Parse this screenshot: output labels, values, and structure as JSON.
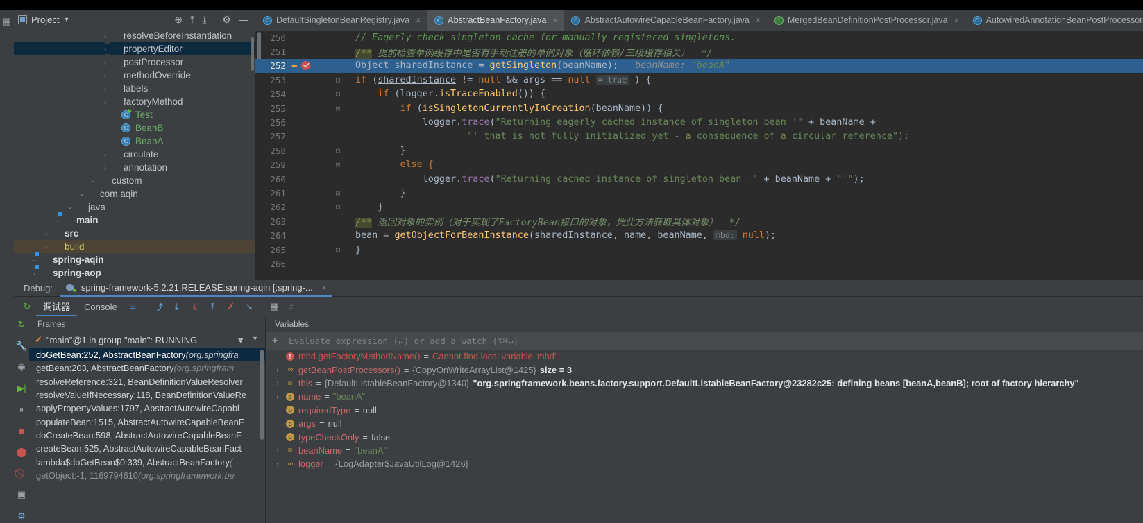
{
  "project_panel": {
    "title": "Project",
    "tools": [
      "locate-icon",
      "expand-all-icon",
      "collapse-all-icon",
      "settings-icon",
      "hide-icon"
    ],
    "tree": [
      {
        "label": "spring-aop",
        "indent": 1,
        "arrow": "›",
        "icon": "module-folder",
        "style": "bold",
        "sel": "none"
      },
      {
        "label": "spring-aqin",
        "indent": 1,
        "arrow": "⌄",
        "icon": "module-folder",
        "style": "bold",
        "sel": "none"
      },
      {
        "label": "build",
        "indent": 2,
        "arrow": "›",
        "icon": "folder-orange",
        "style": "yellowish",
        "sel": "yellow"
      },
      {
        "label": "src",
        "indent": 2,
        "arrow": "⌄",
        "icon": "folder-gray",
        "style": "bold",
        "sel": "none"
      },
      {
        "label": "main",
        "indent": 3,
        "arrow": "⌄",
        "icon": "module-folder",
        "style": "bold",
        "sel": "none"
      },
      {
        "label": "java",
        "indent": 4,
        "arrow": "⌄",
        "icon": "folder-blue",
        "style": "plain",
        "sel": "none"
      },
      {
        "label": "com.aqin",
        "indent": 5,
        "arrow": "⌄",
        "icon": "package",
        "style": "plain",
        "sel": "none"
      },
      {
        "label": "custom",
        "indent": 6,
        "arrow": "⌄",
        "icon": "package",
        "style": "plain",
        "sel": "none"
      },
      {
        "label": "annotation",
        "indent": 7,
        "arrow": "›",
        "icon": "package",
        "style": "plain",
        "sel": "none"
      },
      {
        "label": "circulate",
        "indent": 7,
        "arrow": "⌄",
        "icon": "package",
        "style": "plain",
        "sel": "none"
      },
      {
        "label": "BeanA",
        "indent": 8,
        "arrow": "",
        "icon": "class",
        "style": "green",
        "sel": "none"
      },
      {
        "label": "BeanB",
        "indent": 8,
        "arrow": "",
        "icon": "class",
        "style": "green",
        "sel": "none"
      },
      {
        "label": "Test",
        "indent": 8,
        "arrow": "",
        "icon": "class-runnable",
        "style": "green",
        "sel": "none"
      },
      {
        "label": "factoryMethod",
        "indent": 7,
        "arrow": "›",
        "icon": "package",
        "style": "plain",
        "sel": "none"
      },
      {
        "label": "labels",
        "indent": 7,
        "arrow": "›",
        "icon": "package",
        "style": "plain",
        "sel": "none"
      },
      {
        "label": "methodOverride",
        "indent": 7,
        "arrow": "›",
        "icon": "package",
        "style": "plain",
        "sel": "none"
      },
      {
        "label": "postProcessor",
        "indent": 7,
        "arrow": "›",
        "icon": "package",
        "style": "plain",
        "sel": "none"
      },
      {
        "label": "propertyEditor",
        "indent": 7,
        "arrow": "›",
        "icon": "package",
        "style": "plain",
        "sel": "blue"
      },
      {
        "label": "resolveBeforeInstantiation",
        "indent": 7,
        "arrow": "›",
        "icon": "package",
        "style": "plain",
        "sel": "none"
      }
    ]
  },
  "editor_tabs": [
    {
      "label": "DefaultSingletonBeanRegistry.java",
      "icon": "class",
      "active": false,
      "close": "×"
    },
    {
      "label": "AbstractBeanFactory.java",
      "icon": "class",
      "active": true,
      "close": "×"
    },
    {
      "label": "AbstractAutowireCapableBeanFactory.java",
      "icon": "class",
      "active": false,
      "close": "×"
    },
    {
      "label": "MergedBeanDefinitionPostProcessor.java",
      "icon": "interface",
      "active": false,
      "close": "×"
    },
    {
      "label": "AutowiredAnnotationBeanPostProcessor.java",
      "icon": "class",
      "active": false,
      "close": "×"
    }
  ],
  "editor": {
    "current_line": "252",
    "lines": [
      {
        "n": "250"
      },
      {
        "n": "251"
      },
      {
        "n": "252"
      },
      {
        "n": "253"
      },
      {
        "n": "254"
      },
      {
        "n": "255"
      },
      {
        "n": "256"
      },
      {
        "n": "257"
      },
      {
        "n": "258"
      },
      {
        "n": "259"
      },
      {
        "n": "260"
      },
      {
        "n": "261"
      },
      {
        "n": "262"
      },
      {
        "n": "263"
      },
      {
        "n": "264"
      },
      {
        "n": "265"
      },
      {
        "n": "266"
      }
    ],
    "code": {
      "l250_comment": "// Eagerly check singleton cache for manually registered singletons.",
      "l251_docmark": "/**",
      "l251_doc": " 提前检查单例缓存中是否有手动注册的单例对象（循环依赖/三级缓存相关）  */",
      "l252_type": "Object",
      "l252_var": "sharedInstance",
      "l252_eq": " = ",
      "l252_call": "getSingleton",
      "l252_arg": "beanName",
      "l252_tail": ");",
      "l252_hint": "beanName:",
      "l252_hintval": "\"beanA\"",
      "l253_if": "if",
      "l253_a": "sharedInstance",
      "l253_b": " != ",
      "l253_null1": "null",
      "l253_and": " && ",
      "l253_args": "args",
      "l253_c": " == ",
      "l253_null2": "null",
      "l253_hint": "= true",
      "l253_close": ") {",
      "l254": "if (logger.isTraceEnabled()) {",
      "l254_if": "if",
      "l254_obj": "logger",
      "l254_mth": "isTraceEnabled",
      "l255_if": "if",
      "l255_mth": "isSingletonCurrentlyInCreation",
      "l255_arg": "beanName",
      "l256_obj": "logger",
      "l256_mth": "trace",
      "l256_str": "\"Returning eagerly cached instance of singleton bean '\"",
      "l256_plus": " + ",
      "l256_var": "beanName",
      "l256_plus2": " +",
      "l257_str": "\"' that is not fully initialized yet - a consequence of a circular reference\");",
      "l258": "}",
      "l259": "else {",
      "l260_obj": "logger",
      "l260_mth": "trace",
      "l260_str": "\"Returning cached instance of singleton bean '\"",
      "l260_var": "beanName",
      "l260_str2": "\"'\"",
      "l260_tail": ");",
      "l261": "}",
      "l262": "}",
      "l263_docmark": "/**",
      "l263_doc": " 返回对象的实例（对于实现了FactoryBean接口的对象，凭此方法获取具体对象）  */",
      "l264_lhs": "bean = ",
      "l264_mth": "getObjectForBeanInstance",
      "l264_a": "sharedInstance",
      "l264_b": ", name, beanName, ",
      "l264_hint": "mbd:",
      "l264_null": "null",
      "l264_tail": ");",
      "l265": "}"
    }
  },
  "debug": {
    "label": "Debug:",
    "config_name": "spring-framework-5.2.21.RELEASE:spring-aqin [:spring-...",
    "close": "×",
    "tabs": [
      {
        "label": "调试器",
        "active": true
      },
      {
        "label": "Console",
        "active": false
      }
    ],
    "toolbar_icons": [
      "rerun-icon",
      "layout-icon",
      "step-over-icon",
      "step-into-icon",
      "force-step-into-icon",
      "step-out-icon",
      "drop-frame-icon",
      "run-to-cursor-icon",
      "evaluate-icon",
      "mute-breakpoints-icon"
    ],
    "rail_icons": [
      "rerun-icon",
      "settings-wrench-icon",
      "eye-icon",
      "resume-icon",
      "pause-icon",
      "stop-icon",
      "breakpoints-icon",
      "mute-breakpoints-icon",
      "camera-icon",
      "settings-gear-icon"
    ],
    "frames": {
      "header": "Frames",
      "thread": "\"main\"@1 in group \"main\": RUNNING",
      "thread_check": "✓",
      "filter_icon": "filter-icon",
      "dropdown_icon": "chevron-down-icon",
      "items": [
        {
          "method": "doGetBean:252, AbstractBeanFactory ",
          "pkg": "(org.springfra",
          "selected": true,
          "dim": false
        },
        {
          "method": "getBean:203, AbstractBeanFactory ",
          "pkg": "(org.springfram",
          "selected": false,
          "dim": false
        },
        {
          "method": "resolveReference:321, BeanDefinitionValueResolver",
          "pkg": "",
          "selected": false,
          "dim": false
        },
        {
          "method": "resolveValueIfNecessary:118, BeanDefinitionValueRe",
          "pkg": "",
          "selected": false,
          "dim": false
        },
        {
          "method": "applyPropertyValues:1797, AbstractAutowireCapabl",
          "pkg": "",
          "selected": false,
          "dim": false
        },
        {
          "method": "populateBean:1515, AbstractAutowireCapableBeanF",
          "pkg": "",
          "selected": false,
          "dim": false
        },
        {
          "method": "doCreateBean:598, AbstractAutowireCapableBeanF",
          "pkg": "",
          "selected": false,
          "dim": false
        },
        {
          "method": "createBean:525, AbstractAutowireCapableBeanFact",
          "pkg": "",
          "selected": false,
          "dim": false
        },
        {
          "method": "lambda$doGetBean$0:339, AbstractBeanFactory ",
          "pkg": "(",
          "selected": false,
          "dim": false
        },
        {
          "method": "getObject:-1, 1169794610 ",
          "pkg": "(org.springframework.be",
          "selected": false,
          "dim": true
        }
      ]
    },
    "variables": {
      "header": "Variables",
      "watch_placeholder": "Evaluate expression (↵) or add a watch (⌥⌘↵)",
      "watch_plus": "+",
      "watch_minus": "−",
      "items": [
        {
          "expand": "",
          "icon": "error",
          "name": "mbd.getFactoryMethodName()",
          "eq": " = ",
          "value": "Cannot find local variable 'mbd'",
          "value_style": "err",
          "extra": "",
          "extra2": ""
        },
        {
          "expand": "›",
          "icon": "method",
          "name": "getBeanPostProcessors()",
          "eq": " = ",
          "value": "{CopyOnWriteArrayList@1425}",
          "value_style": "gray",
          "extra": "size = 3",
          "extra2": ""
        },
        {
          "expand": "›",
          "icon": "obj",
          "name": "this",
          "eq": " = ",
          "value": "{DefaultListableBeanFactory@1340}",
          "value_style": "gray",
          "extra": "\"org.springframework.beans.factory.support.DefaultListableBeanFactory@23282c25: defining beans [beanA,beanB]; root of factory hierarchy\"",
          "extra2": ""
        },
        {
          "expand": "›",
          "icon": "param",
          "name": "name",
          "eq": " = ",
          "value": "\"beanA\"",
          "value_style": "green",
          "extra": "",
          "extra2": ""
        },
        {
          "expand": "",
          "icon": "param",
          "name": "requiredType",
          "eq": " = ",
          "value": "null",
          "value_style": "plain",
          "extra": "",
          "extra2": ""
        },
        {
          "expand": "",
          "icon": "param",
          "name": "args",
          "eq": " = ",
          "value": "null",
          "value_style": "plain",
          "extra": "",
          "extra2": ""
        },
        {
          "expand": "",
          "icon": "param",
          "name": "typeCheckOnly",
          "eq": " = ",
          "value": "false",
          "value_style": "plain",
          "extra": "",
          "extra2": ""
        },
        {
          "expand": "›",
          "icon": "obj",
          "name": "beanName",
          "eq": " = ",
          "value": "\"beanA\"",
          "value_style": "green",
          "extra": "",
          "extra2": ""
        },
        {
          "expand": "›",
          "icon": "method",
          "name": "logger",
          "eq": " = ",
          "value": "{LogAdapter$JavaUtilLog@1426}",
          "value_style": "gray",
          "extra": "",
          "extra2": ""
        }
      ]
    }
  },
  "colors": {
    "panel_bg": "#3c3f41",
    "editor_bg": "#2b2b2b",
    "selection_blue": "#2d5f8f",
    "accent_blue": "#4a88c7",
    "error_red": "#c75450",
    "string_green": "#6a8759"
  }
}
